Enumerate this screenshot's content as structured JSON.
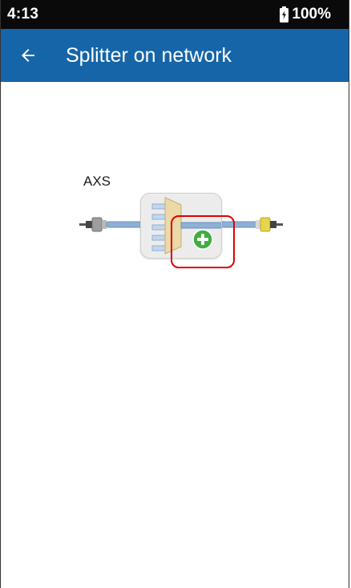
{
  "status_bar": {
    "time": "4:13",
    "battery_percent": "100%",
    "battery_icon": "battery-charging-icon"
  },
  "app_bar": {
    "back_icon": "arrow-back-icon",
    "title": "Splitter on network",
    "color": "#1565a8"
  },
  "diagram": {
    "module_label": "AXS",
    "left_connector_color": "#9e9e9e",
    "right_connector_color": "#e8d54a",
    "fiber_color": "#8fb0d6",
    "splitter_icon": "splitter-icon",
    "add_icon": "add-circle-icon",
    "add_color": "#3fae3f",
    "highlight_color": "#e00000"
  }
}
